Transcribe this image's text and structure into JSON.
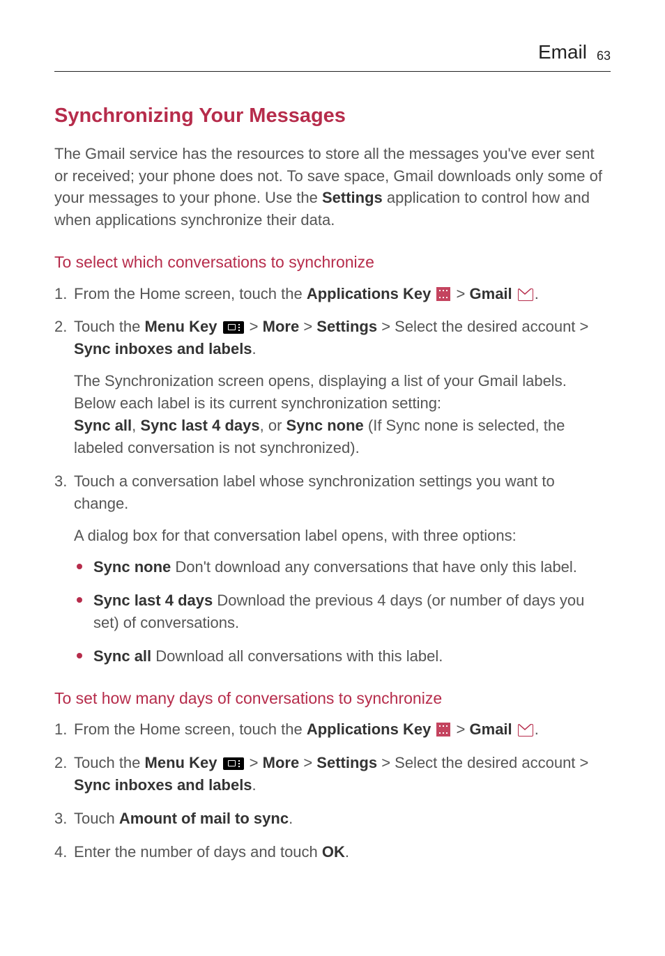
{
  "header": {
    "section": "Email",
    "page": "63"
  },
  "h2": "Synchronizing Your Messages",
  "intro_a": "The Gmail service has the resources to store all the messages you've ever sent or received; your phone does not. To save space, Gmail downloads only some of your messages to your phone. Use the ",
  "intro_settings": "Settings",
  "intro_b": " application to control how and when applications synchronize their data.",
  "section1": {
    "title": "To select which conversations to synchronize",
    "step1_a": "From the Home screen, touch the ",
    "step1_appkey": "Applications Key",
    "step1_b": " > ",
    "step1_gmail": "Gmail",
    "step1_c": ".",
    "step2_a": "Touch the ",
    "step2_menukey": "Menu Key",
    "step2_b": " > ",
    "step2_more": "More",
    "step2_c": " > ",
    "step2_settings": "Settings",
    "step2_d": " > Select the desired account > ",
    "step2_sync": "Sync inboxes and labels",
    "step2_e": ".",
    "step2_inner_a": "The Synchronization screen opens, displaying a list of your Gmail labels. Below each label is its current synchronization setting:",
    "step2_inner_b1": "Sync all",
    "step2_inner_b2": ", ",
    "step2_inner_b3": "Sync last 4 days",
    "step2_inner_b4": ", or ",
    "step2_inner_b5": "Sync none",
    "step2_inner_b6": " (If Sync none is selected, the labeled conversation is not synchronized).",
    "step3_a": "Touch a conversation label whose synchronization settings you want to change.",
    "step3_inner": "A dialog box for that conversation label opens, with three options:",
    "bullets": {
      "b1_bold": "Sync none",
      "b1_text": "  Don't download any conversations that have only this label.",
      "b2_bold": "Sync last 4 days",
      "b2_text": "  Download the previous 4 days (or number of days you set) of conversations.",
      "b3_bold": "Sync all",
      "b3_text": "  Download all conversations with this label."
    }
  },
  "section2": {
    "title": "To set how many days of conversations to synchronize",
    "step1_a": "From the Home screen, touch the ",
    "step1_appkey": "Applications Key",
    "step1_b": " > ",
    "step1_gmail": "Gmail",
    "step1_c": ".",
    "step2_a": "Touch the ",
    "step2_menukey": "Menu Key",
    "step2_b": " > ",
    "step2_more": "More",
    "step2_c": " > ",
    "step2_settings": "Settings",
    "step2_d": " > Select the desired account > ",
    "step2_sync": "Sync inboxes and labels",
    "step2_e": ".",
    "step3_a": "Touch ",
    "step3_bold": "Amount of mail to sync",
    "step3_b": ".",
    "step4_a": "Enter the number of days and touch ",
    "step4_bold": "OK",
    "step4_b": "."
  }
}
